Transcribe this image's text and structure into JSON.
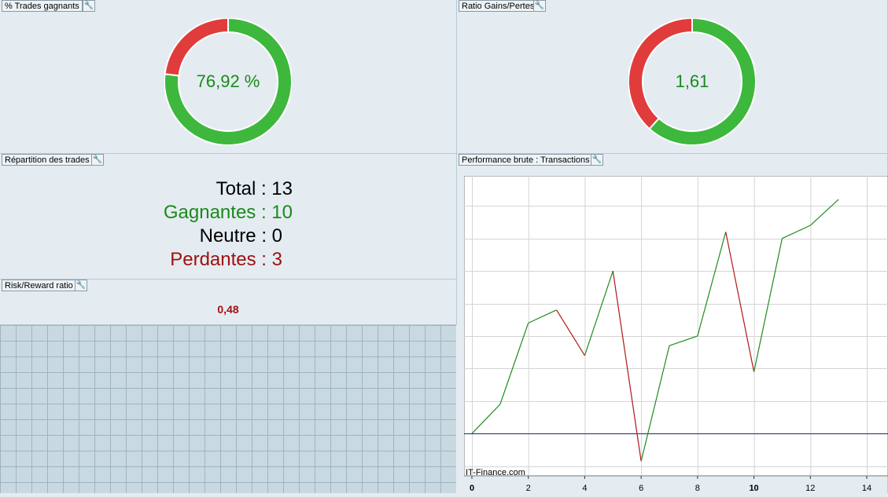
{
  "panels": {
    "win_pct": {
      "title": "% Trades gagnants",
      "value_label": "76,92 %",
      "win_fraction": 0.7692
    },
    "ratio": {
      "title": "Ratio Gains/Pertes",
      "value_label": "1,61",
      "gain_fraction": 0.617
    },
    "repartition": {
      "title": "Répartition des trades",
      "total": "Total : 13",
      "gagnantes": "Gagnantes : 10",
      "neutre": "Neutre : 0",
      "perdantes": "Perdantes : 3"
    },
    "risk_reward": {
      "title": "Risk/Reward ratio",
      "value": "0,48"
    },
    "performance": {
      "title": "Performance brute : Transactions",
      "watermark": "IT-Finance.com"
    }
  },
  "colors": {
    "win": "#3db83d",
    "loss": "#e03c3c",
    "green_text": "#1a8a1a",
    "red_text": "#a01010",
    "baseline": "#1a237e"
  },
  "icons": {
    "wrench": "wrench-icon"
  },
  "chart_data": {
    "type": "line",
    "x": [
      0,
      1,
      2,
      3,
      4,
      5,
      6,
      7,
      8,
      9,
      10,
      11,
      12,
      13
    ],
    "y": [
      0,
      0.9,
      3.4,
      3.8,
      2.4,
      5.0,
      -0.85,
      2.7,
      3.0,
      6.2,
      1.9,
      6.0,
      6.4,
      7.2
    ],
    "segment_colors": [
      "win",
      "win",
      "win",
      "loss",
      "win",
      "loss",
      "win",
      "win",
      "win",
      "loss",
      "win",
      "win",
      "win"
    ],
    "xticks": [
      "0",
      "2",
      "4",
      "6",
      "8",
      "10",
      "12",
      "14"
    ],
    "xlim": [
      0,
      14.6
    ],
    "ylim": [
      -1.3,
      7.9
    ],
    "baseline": 0,
    "grid": true
  }
}
